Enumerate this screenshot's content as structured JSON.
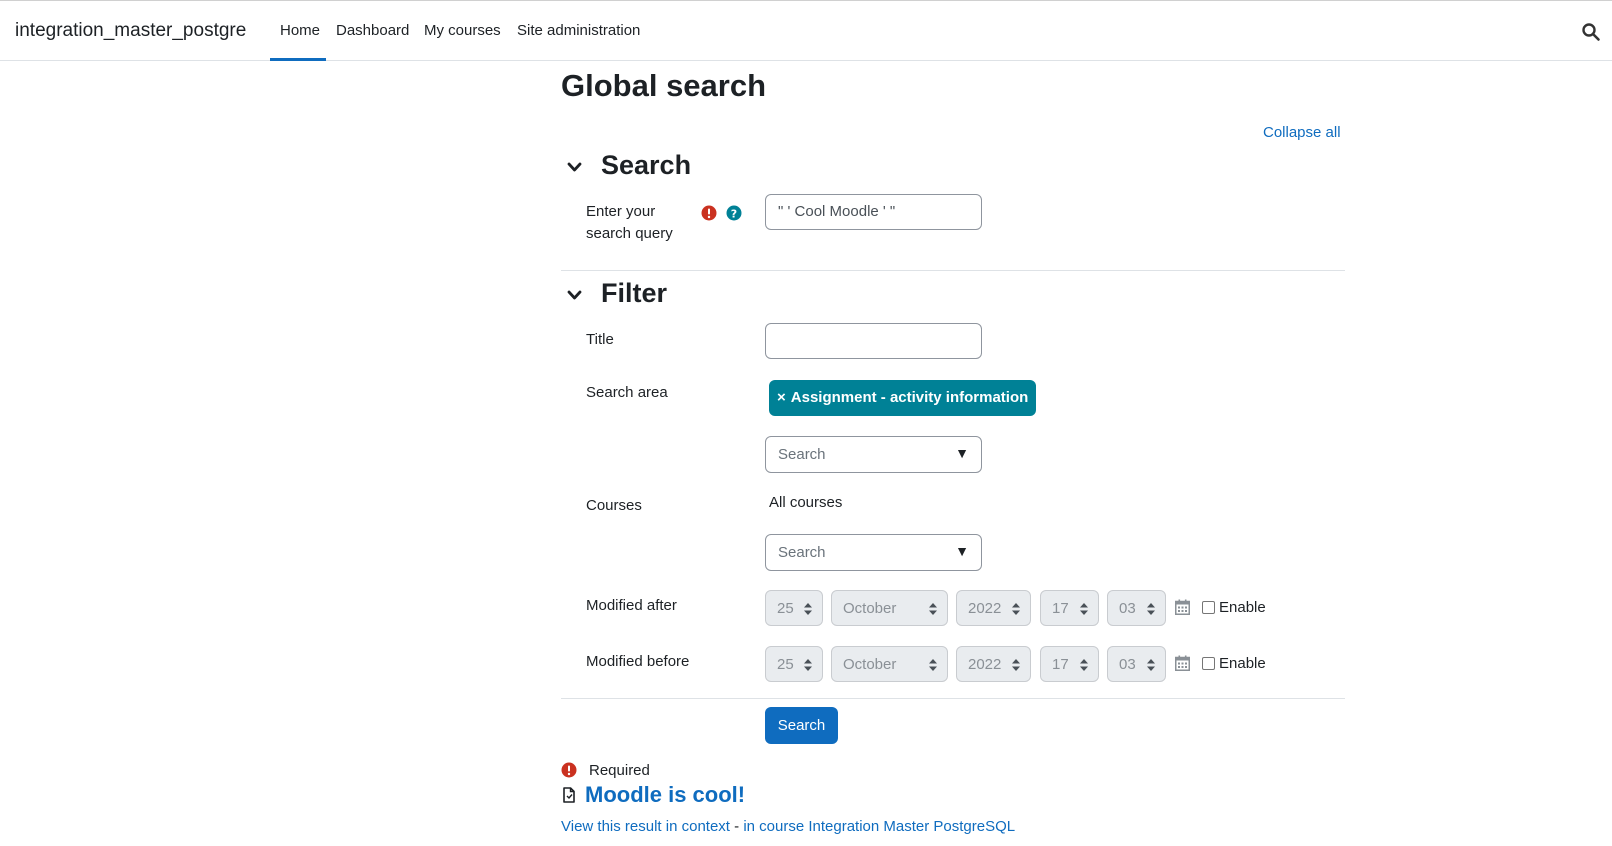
{
  "site": {
    "name": "integration_master_postgre"
  },
  "nav": {
    "items": [
      {
        "label": "Home",
        "active": true
      },
      {
        "label": "Dashboard"
      },
      {
        "label": "My courses"
      },
      {
        "label": "Site administration"
      }
    ],
    "search_icon": "search-icon"
  },
  "page": {
    "title": "Global search",
    "collapse_all": "Collapse all"
  },
  "search_section": {
    "title": "Search",
    "query_label": "Enter your search query",
    "query_value": "\" ' Cool Moodle ' \""
  },
  "filter_section": {
    "title": "Filter",
    "title_label": "Title",
    "title_value": "",
    "search_area_label": "Search area",
    "search_area_tag": "Assignment - activity information",
    "search_area_tag_remove": "×",
    "search_area_placeholder": "Search",
    "courses_label": "Courses",
    "courses_value": "All courses",
    "courses_placeholder": "Search",
    "dropdown_arrow": "▼",
    "modified_after": {
      "label": "Modified after",
      "day": "25",
      "month": "October",
      "year": "2022",
      "hour": "17",
      "minute": "03",
      "enable_label": "Enable",
      "enabled": false
    },
    "modified_before": {
      "label": "Modified before",
      "day": "25",
      "month": "October",
      "year": "2022",
      "hour": "17",
      "minute": "03",
      "enable_label": "Enable",
      "enabled": false
    }
  },
  "submit": {
    "label": "Search"
  },
  "required_note": "Required",
  "result": {
    "title": "Moodle is cool!",
    "context_link": "View this result in context",
    "separator": " - ",
    "course_link": "in course Integration Master PostgreSQL"
  },
  "colors": {
    "primary": "#0f6cbf",
    "badge": "#008196",
    "danger": "#ca3120",
    "info": "#008196",
    "text": "#1d2125"
  }
}
